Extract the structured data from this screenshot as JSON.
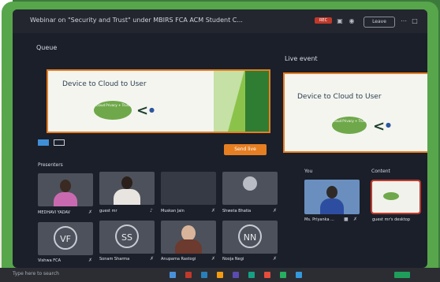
{
  "window": {
    "title": "Webinar on \"Security and Trust\" under MBIRS FCA ACM Student C..."
  },
  "toolbar": {
    "rec_label": "REC",
    "right_button": "Leave"
  },
  "queue": {
    "label": "Queue",
    "slide_title": "Device to Cloud to User",
    "cloud_text": "Cloud\nPrivacy + Trust"
  },
  "live": {
    "label": "Live event",
    "slide_title": "Device to Cloud to User",
    "cloud_text": "Cloud\nPrivacy + Trust"
  },
  "send_live_label": "Send live",
  "presenters": {
    "label": "Presenters",
    "tiles": [
      {
        "name": "MEDHAVI YADAV",
        "initials": ""
      },
      {
        "name": "guest mr",
        "initials": ""
      },
      {
        "name": "Muskan Jain",
        "initials": ""
      },
      {
        "name": "Shweta Bhatia",
        "initials": ""
      },
      {
        "name": "Vishwa FCA",
        "initials": "VF"
      },
      {
        "name": "Sonam Sharma",
        "initials": "SS"
      },
      {
        "name": "Anupama Rastogi",
        "initials": ""
      },
      {
        "name": "Nooja Negi",
        "initials": "NN"
      }
    ]
  },
  "you": {
    "label": "You",
    "name": "Ms. Priyanka ..."
  },
  "content": {
    "label": "Content",
    "name": "guest mr's desktop"
  },
  "taskbar": {
    "search_placeholder": "Type here to search"
  }
}
